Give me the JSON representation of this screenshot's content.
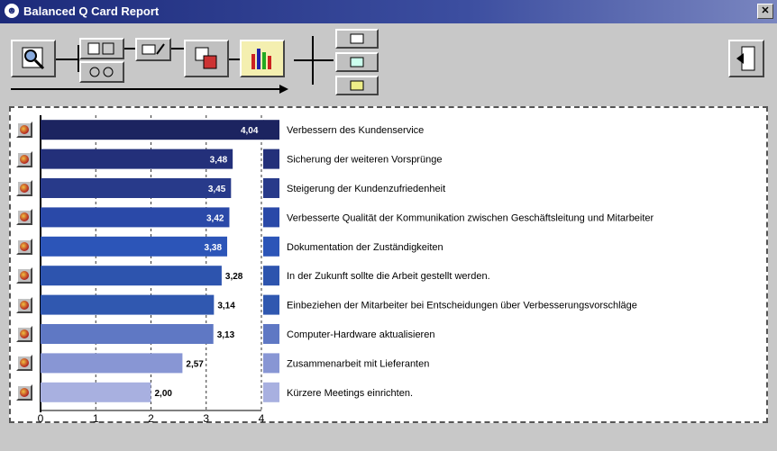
{
  "window": {
    "title": "Balanced Q Card Report",
    "close_glyph": "✕"
  },
  "toolbar": {
    "buttons": [
      {
        "name": "preview-button",
        "icon": "magnifier-icon"
      },
      {
        "name": "data-input-button",
        "icon": "data-input-icon"
      },
      {
        "name": "data-link-button",
        "icon": "data-link-icon"
      },
      {
        "name": "edit-button",
        "icon": "edit-icon"
      },
      {
        "name": "layout-button",
        "icon": "layout-icon"
      },
      {
        "name": "chart-button",
        "icon": "bar-chart-icon"
      },
      {
        "name": "option-top-button",
        "icon": "option-icon"
      },
      {
        "name": "option-middle-button",
        "icon": "option-icon"
      },
      {
        "name": "option-bottom-button",
        "icon": "option-icon"
      },
      {
        "name": "exit-button",
        "icon": "exit-icon"
      }
    ]
  },
  "chart_data": {
    "type": "bar",
    "orientation": "horizontal",
    "categories": [
      "Verbessern des Kundenservice",
      "Sicherung der weiteren Vorsprünge",
      "Steigerung der Kundenzufriedenheit",
      "Verbesserte Qualität der Kommunikation zwischen Geschäftsleitung und Mitarbeiter",
      "Dokumentation der Zuständigkeiten",
      "In der Zukunft sollte die Arbeit gestellt werden.",
      "Einbeziehen der Mitarbeiter bei Entscheidungen über Verbesserungsvorschläge",
      "Computer-Hardware aktualisieren",
      "Zusammenarbeit mit Lieferanten",
      "Kürzere Meetings einrichten."
    ],
    "values": [
      4.04,
      3.48,
      3.45,
      3.42,
      3.38,
      3.28,
      3.14,
      3.13,
      2.57,
      2.0
    ],
    "value_labels": [
      "4,04",
      "3,48",
      "3,45",
      "3,42",
      "3,38",
      "3,28",
      "3,14",
      "3,13",
      "2,57",
      "2,00"
    ],
    "colors": [
      "#1c2460",
      "#23307a",
      "#283a8a",
      "#2a49a8",
      "#2c55b8",
      "#2d54ae",
      "#3058b0",
      "#5f78c4",
      "#8896d4",
      "#a8b0e0"
    ],
    "xlim": [
      0,
      4
    ],
    "x_ticks": [
      "0",
      "1",
      "2",
      "3",
      "4"
    ],
    "grid": true
  }
}
